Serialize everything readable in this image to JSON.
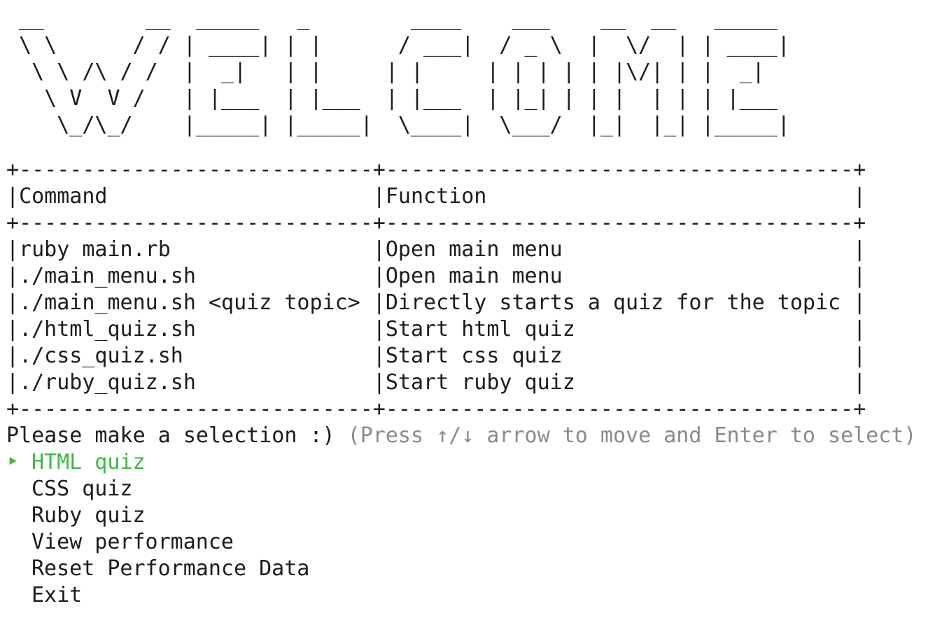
{
  "banner": {
    "lines": [
      " __        __  _____   _        ____    ___    __  __   _____ ",
      " \\ \\      / / | ____| | |      / ___|  / _ \\  |  \\/  | | ____|",
      "  \\ \\ /\\ / /  |  _|   | |     | |     | | | | | |\\/| | |  _|  ",
      "   \\ V  V /   | |___  | |___  | |___  | |_| | | |  | | | |___ ",
      "    \\_/\\_/    |_____| |_____|  \\____|  \\___/  |_|  |_| |_____|"
    ]
  },
  "table": {
    "border": "+----------------------------+-------------------------------------+",
    "header": {
      "command": "Command",
      "function": "Function"
    },
    "rows": [
      {
        "command": "ruby main.rb",
        "function": "Open main menu"
      },
      {
        "command": "./main_menu.sh",
        "function": "Open main menu"
      },
      {
        "command": "./main_menu.sh <quiz topic>",
        "function": "Directly starts a quiz for the topic"
      },
      {
        "command": "./html_quiz.sh",
        "function": "Start html quiz"
      },
      {
        "command": "./css_quiz.sh",
        "function": "Start css quiz"
      },
      {
        "command": "./ruby_quiz.sh",
        "function": "Start ruby quiz"
      }
    ]
  },
  "prompt": {
    "question": "Please make a selection :)",
    "hint": "(Press ↑/↓ arrow to move and Enter to select)"
  },
  "menu": {
    "cursor": "‣",
    "items": [
      {
        "label": "HTML quiz",
        "selected": true
      },
      {
        "label": "CSS quiz",
        "selected": false
      },
      {
        "label": "Ruby quiz",
        "selected": false
      },
      {
        "label": "View performance",
        "selected": false
      },
      {
        "label": "Reset Performance Data",
        "selected": false
      },
      {
        "label": "Exit",
        "selected": false
      }
    ]
  },
  "colors": {
    "selected": "#3fb845",
    "hint": "#8a8a8a",
    "text": "#1c1c1c"
  }
}
